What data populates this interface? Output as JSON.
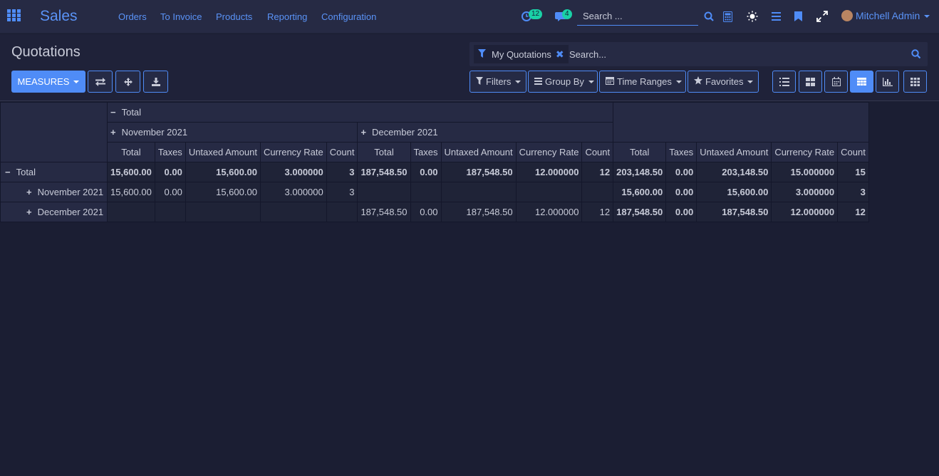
{
  "topbar": {
    "app_name": "Sales",
    "menu": [
      "Orders",
      "To Invoice",
      "Products",
      "Reporting",
      "Configuration"
    ],
    "activity_count": "12",
    "message_count": "4",
    "search_placeholder": "Search ...",
    "user_name": "Mitchell Admin"
  },
  "control_panel": {
    "title": "Quotations",
    "measures_label": "MEASURES",
    "facet_label": "My Quotations",
    "search_placeholder": "Search...",
    "filters_label": "Filters",
    "groupby_label": "Group By",
    "timeranges_label": "Time Ranges",
    "favorites_label": "Favorites"
  },
  "pivot": {
    "col_total_label": "Total",
    "col_groups": [
      "November 2021",
      "December 2021"
    ],
    "measures": [
      "Total",
      "Taxes",
      "Untaxed Amount",
      "Currency Rate",
      "Count"
    ],
    "rows": [
      {
        "label": "Total",
        "values": [
          "15,600.00",
          "0.00",
          "15,600.00",
          "3.000000",
          "3",
          "187,548.50",
          "0.00",
          "187,548.50",
          "12.000000",
          "12",
          "203,148.50",
          "0.00",
          "203,148.50",
          "15.000000",
          "15"
        ]
      },
      {
        "label": "November 2021",
        "values": [
          "15,600.00",
          "0.00",
          "15,600.00",
          "3.000000",
          "3",
          "",
          "",
          "",
          "",
          "",
          "15,600.00",
          "0.00",
          "15,600.00",
          "3.000000",
          "3"
        ]
      },
      {
        "label": "December 2021",
        "values": [
          "",
          "",
          "",
          "",
          "",
          "187,548.50",
          "0.00",
          "187,548.50",
          "12.000000",
          "12",
          "187,548.50",
          "0.00",
          "187,548.50",
          "12.000000",
          "12"
        ]
      }
    ]
  },
  "colors": {
    "accent": "#4f8cf7",
    "background": "#1b1e33",
    "badge": "#19d1a6"
  }
}
